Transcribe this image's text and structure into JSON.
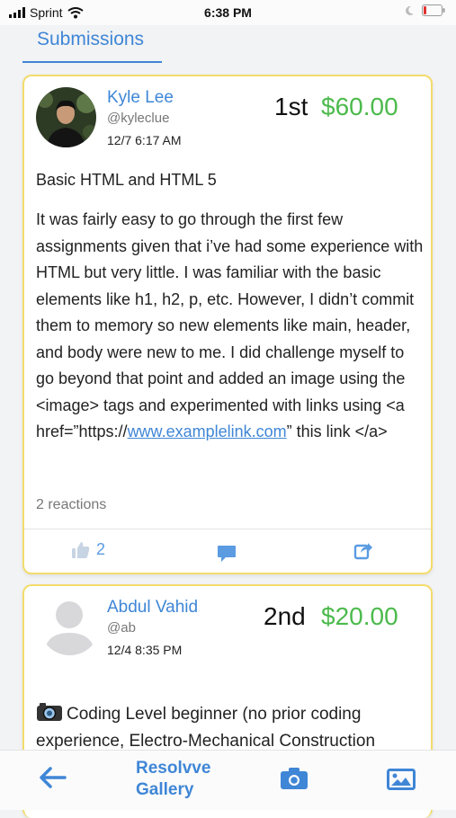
{
  "status": {
    "carrier": "Sprint",
    "time": "6:38 PM"
  },
  "tabs": {
    "active": "Submissions"
  },
  "submissions": [
    {
      "name": "Kyle Lee",
      "handle": "@kyleclue",
      "date": "12/7 6:17 AM",
      "rank": "1st",
      "prize": "$60.00",
      "title": "Basic HTML and HTML 5",
      "body_before_link": "It was fairly easy to go through the first few assignments given that i’ve had some experience with HTML but very little. I was familiar with the basic elements like h1, h2, p, etc. However, I didn’t commit them to memory so new elements like main, header, and body were new to me. I did challenge myself to go beyond that point and added an image using the <image> tags and experimented with links using <a href=”https://",
      "link_text": "www.examplelink.com",
      "body_after_link": "” this link </a>",
      "reactions": "2 reactions",
      "like_count": "2"
    },
    {
      "name": "Abdul Vahid",
      "handle": "@ab",
      "date": "12/4 8:35 PM",
      "rank": "2nd",
      "prize": "$20.00",
      "title": "Coding Level beginner (no prior coding experience, Electro-Mechanical Construction"
    }
  ],
  "bottom_bar": {
    "title": "Resolvve Gallery",
    "line1": "Resolvve",
    "line2": "Gallery"
  },
  "colors": {
    "accent": "#3f86d6",
    "prize": "#4cba4c",
    "card_border": "#f3dc6b"
  },
  "icons": [
    "wifi-icon",
    "moon-icon",
    "battery-icon",
    "thumbs-up-icon",
    "comment-icon",
    "share-icon",
    "back-arrow-icon",
    "camera-icon",
    "image-icon"
  ]
}
